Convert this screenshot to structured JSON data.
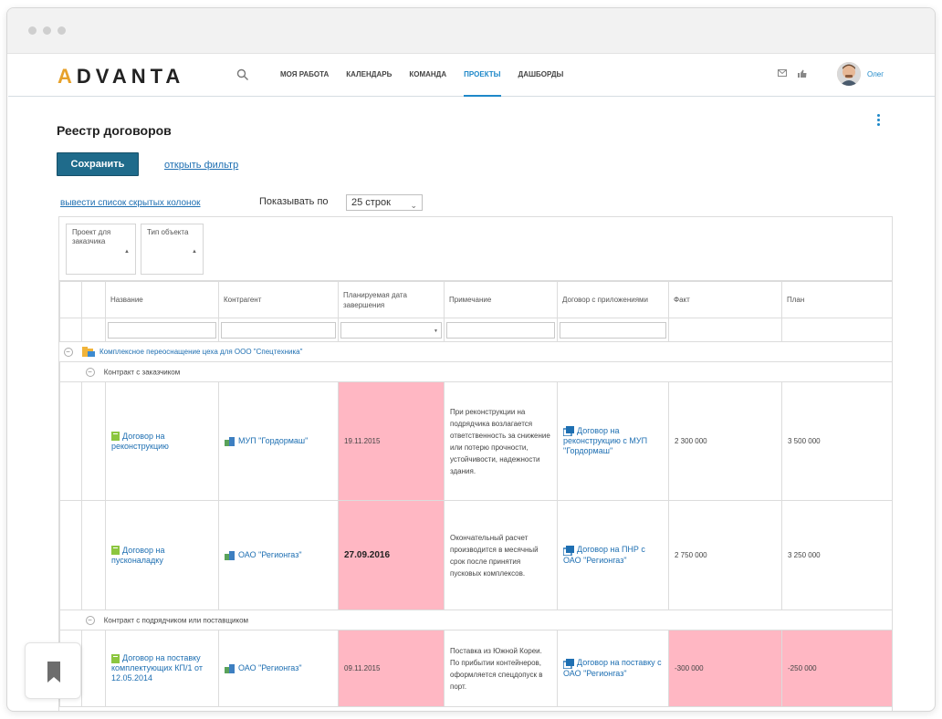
{
  "app": {
    "logo": "ADVANTA",
    "user_name": "Олег"
  },
  "nav": [
    {
      "label": "МОЯ РАБОТА"
    },
    {
      "label": "КАЛЕНДАРЬ"
    },
    {
      "label": "КОМАНДА"
    },
    {
      "label": "ПРОЕКТЫ",
      "active": true
    },
    {
      "label": "ДАШБОРДЫ"
    }
  ],
  "page": {
    "title": "Реестр договоров",
    "save_label": "Сохранить",
    "filter_link": "открыть фильтр",
    "hidden_columns_link": "вывести список скрытых колонок",
    "show_label": "Показывать по",
    "page_size": "25 строк"
  },
  "group_chips": [
    "Проект для заказчика",
    "Тип объекта"
  ],
  "columns": [
    "Название",
    "Контрагент",
    "Планируемая дата завершения",
    "Примечание",
    "Договор с приложениями",
    "Факт",
    "План"
  ],
  "project": {
    "name": "Комплексное переоснащение цеха для ООО \"Спецтехника\""
  },
  "groups": [
    {
      "label": "Контракт с заказчиком",
      "rows": [
        {
          "name": "Договор на реконструкцию",
          "counterparty": "МУП \"Гордормаш\"",
          "date": "19.11.2015",
          "note": "При реконструкции на подрядчика возлагается ответственность за снижение или потерю прочности, устойчивости, надежности здания.",
          "contract": "Договор на реконструкцию с МУП \"Гордормаш\"",
          "fact": "2 300 000",
          "plan": "3 500 000"
        },
        {
          "name": "Договор на пусконаладку",
          "counterparty": "ОАО \"Регионгаз\"",
          "date": "27.09.2016",
          "note": "Окончательный расчет производится в месячный срок после принятия пусковых комплексов.",
          "contract": "Договор на ПНР с ОАО \"Регионгаз\"",
          "fact": "2 750 000",
          "plan": "3 250 000"
        }
      ]
    },
    {
      "label": "Контракт с подрядчиком или поставщиком",
      "rows": [
        {
          "name": "Договор на поставку комплектующих КП/1 от 12.05.2014",
          "counterparty": "ОАО \"Регионгаз\"",
          "date": "09.11.2015",
          "note": "Поставка из Южной Кореи. По прибытии контейнеров, оформляется спецдопуск в порт.",
          "contract": "Договор на поставку с ОАО \"Регионгаз\"",
          "fact": "-300 000",
          "plan": "-250 000"
        }
      ]
    }
  ]
}
